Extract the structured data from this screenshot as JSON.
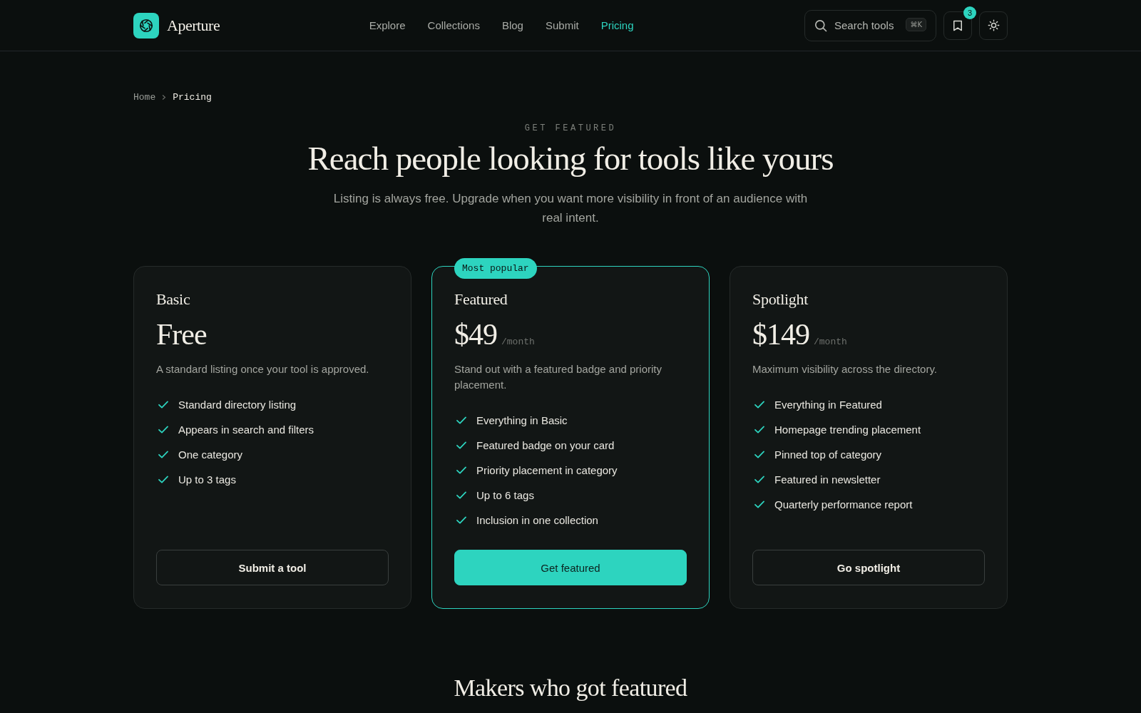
{
  "header": {
    "logo": {
      "name": "Aperture"
    },
    "nav": [
      {
        "label": "Explore",
        "selected": false
      },
      {
        "label": "Collections",
        "selected": false
      },
      {
        "label": "Blog",
        "selected": false
      },
      {
        "label": "Submit",
        "selected": false
      },
      {
        "label": "Pricing",
        "selected": true
      }
    ],
    "search": {
      "placeholder": "Search tools",
      "shortcut": "⌘K"
    },
    "saved_count": "3"
  },
  "breadcrumb": [
    {
      "label": "Home",
      "selected": false
    },
    {
      "label": "Pricing",
      "selected": true
    }
  ],
  "hero": {
    "eyebrow": "GET FEATURED",
    "title": "Reach people looking for tools like yours",
    "subtitle": "Listing is always free. Upgrade when you want more visibility in front of an audience with real intent."
  },
  "plans": [
    {
      "name": "Basic",
      "price": "Free",
      "highlighted": false,
      "description": "A standard listing once your tool is approved.",
      "features": [
        "Standard directory listing",
        "Appears in search and filters",
        "One category",
        "Up to 3 tags"
      ],
      "button": "Submit a tool"
    },
    {
      "name": "Featured",
      "price": "$49",
      "period": "/month",
      "badge": "Most popular",
      "highlighted": true,
      "description": "Stand out with a featured badge and priority placement.",
      "features": [
        "Everything in Basic",
        "Featured badge on your card",
        "Priority placement in category",
        "Up to 6 tags",
        "Inclusion in one collection"
      ],
      "button": "Get featured"
    },
    {
      "name": "Spotlight",
      "price": "$149",
      "period": "/month",
      "highlighted": false,
      "description": "Maximum visibility across the directory.",
      "features": [
        "Everything in Featured",
        "Homepage trending placement",
        "Pinned top of category",
        "Featured in newsletter",
        "Quarterly performance report"
      ],
      "button": "Go spotlight"
    }
  ],
  "next_section": {
    "title": "Makers who got featured"
  }
}
